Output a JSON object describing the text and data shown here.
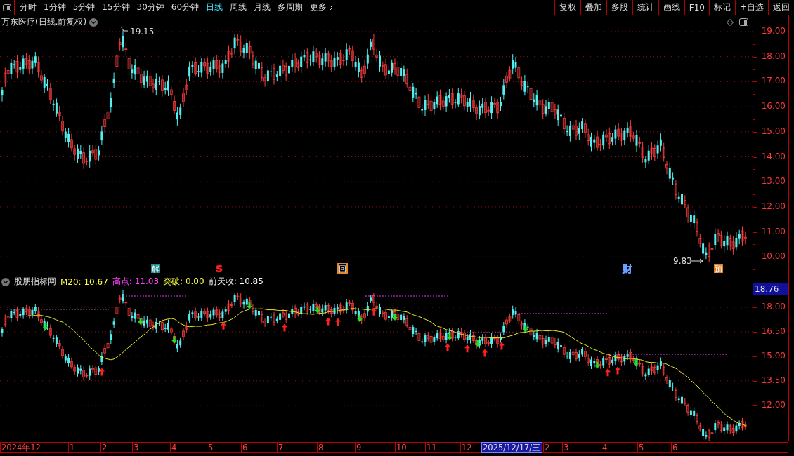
{
  "toolbar": {
    "tabs": [
      {
        "label": "分时",
        "selected": false
      },
      {
        "label": "1分钟",
        "selected": false
      },
      {
        "label": "5分钟",
        "selected": false
      },
      {
        "label": "15分钟",
        "selected": false
      },
      {
        "label": "30分钟",
        "selected": false
      },
      {
        "label": "60分钟",
        "selected": false
      },
      {
        "label": "日线",
        "selected": true
      },
      {
        "label": "周线",
        "selected": false
      },
      {
        "label": "月线",
        "selected": false
      },
      {
        "label": "多周期",
        "selected": false
      },
      {
        "label": "更多",
        "selected": false
      }
    ],
    "buttons": [
      "复权",
      "叠加",
      "多股",
      "统计",
      "画线",
      "F10",
      "标记",
      "+自选",
      "返回"
    ]
  },
  "price_panel": {
    "title": "万东医疗(日线.前复权)",
    "high_label": "19.15",
    "low_label": "9.83",
    "markers": [
      {
        "text": "解",
        "kind": "filled",
        "color": "#1e8c8c"
      },
      {
        "text": "S",
        "kind": "plain",
        "color": "#ff2020"
      },
      {
        "text": "回",
        "kind": "outline",
        "color": "#e08a30"
      },
      {
        "text": "财",
        "kind": "plain",
        "color": "#6aa0ff"
      },
      {
        "text": "预",
        "kind": "filled",
        "color": "#e07a20"
      }
    ],
    "y_axis": [
      "19.00",
      "18.00",
      "17.00",
      "16.00",
      "15.00",
      "14.00",
      "13.00",
      "12.00",
      "11.00",
      "10.00"
    ]
  },
  "indicator_panel": {
    "title": "股朋指标网",
    "legend": [
      {
        "label": "M20:",
        "value": "10.67",
        "color": "#ffff40"
      },
      {
        "label": "高点:",
        "value": "11.03",
        "color": "#ff40ff"
      },
      {
        "label": "突破:",
        "value": "0.00",
        "color": "#ffff40"
      },
      {
        "label": "前天收:",
        "value": "10.85",
        "color": "#ffffff"
      }
    ],
    "current_value": "18.76",
    "y_axis": [
      "18.00",
      "16.50",
      "15.00",
      "13.50",
      "12.00"
    ]
  },
  "date_axis": {
    "labels": [
      {
        "text": "2024年12",
        "selected": false
      },
      {
        "text": "1",
        "selected": false
      },
      {
        "text": "2",
        "selected": false
      },
      {
        "text": "3",
        "selected": false
      },
      {
        "text": "4",
        "selected": false
      },
      {
        "text": "5",
        "selected": false
      },
      {
        "text": "6",
        "selected": false
      },
      {
        "text": "7",
        "selected": false
      },
      {
        "text": "8",
        "selected": false
      },
      {
        "text": "9",
        "selected": false
      },
      {
        "text": "10",
        "selected": false
      },
      {
        "text": "11",
        "selected": false
      },
      {
        "text": "12",
        "selected": false
      },
      {
        "text": "2025/12/17/三",
        "selected": true
      },
      {
        "text": "2",
        "selected": false
      },
      {
        "text": "3",
        "selected": false
      },
      {
        "text": "4",
        "selected": false
      },
      {
        "text": "5",
        "selected": false
      },
      {
        "text": "6",
        "selected": false
      }
    ]
  }
}
